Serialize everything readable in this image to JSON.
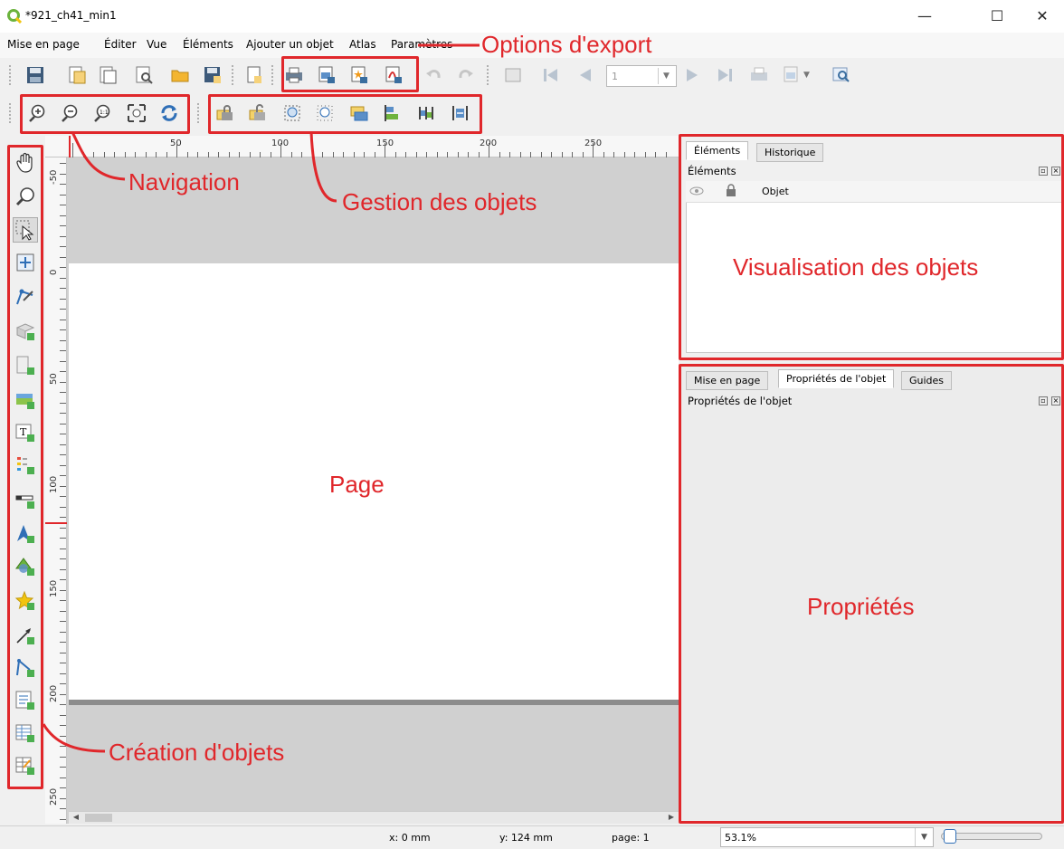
{
  "window": {
    "title": "*921_ch41_min1",
    "minimize": "—",
    "maximize": "☐",
    "close": "✕"
  },
  "menubar": {
    "items": [
      "Mise en page",
      "Éditer",
      "Vue",
      "Éléments",
      "Ajouter un objet",
      "Atlas",
      "Paramètres"
    ]
  },
  "toolbar": {
    "page_field": "1"
  },
  "annotations": {
    "export": "Options d'export",
    "navigation": "Navigation",
    "objects_mgmt": "Gestion des objets",
    "visualisation": "Visualisation des objets",
    "page": "Page",
    "properties": "Propriétés",
    "creation": "Création d'objets"
  },
  "ruler": {
    "top_labels": [
      "50",
      "100",
      "150",
      "200",
      "250"
    ],
    "left_labels": [
      "-50",
      "0",
      "50",
      "100",
      "150",
      "200",
      "250"
    ]
  },
  "items_panel": {
    "tabs": [
      "Éléments",
      "Historique"
    ],
    "title": "Éléments",
    "column_object": "Objet"
  },
  "props_panel": {
    "tabs": [
      "Mise en page",
      "Propriétés de l'objet",
      "Guides"
    ],
    "title": "Propriétés de l'objet"
  },
  "statusbar": {
    "x": "x: 0 mm",
    "y": "y: 124 mm",
    "page": "page: 1",
    "zoom": "53.1%"
  },
  "colors": {
    "annotation": "#e0272b",
    "accent_blue": "#2f6fb7",
    "qgis_green": "#6bb33d"
  }
}
